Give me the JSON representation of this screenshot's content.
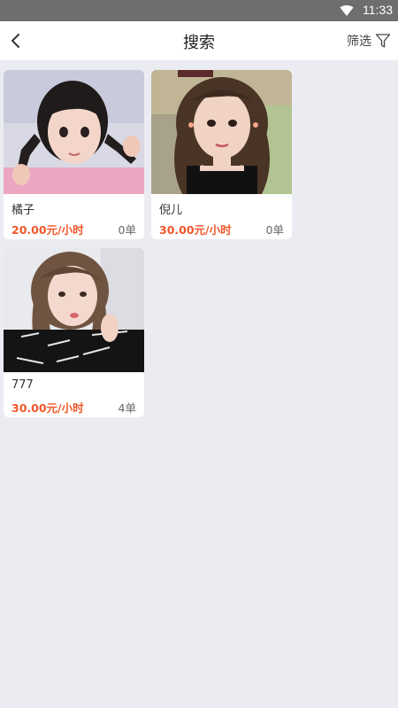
{
  "status_bar": {
    "time": "11:33",
    "wifi_icon": "wifi-icon"
  },
  "header": {
    "title": "搜索",
    "back_icon": "chevron-left-icon",
    "filter_label": "筛选",
    "filter_icon": "funnel-icon"
  },
  "results": [
    {
      "name": "橘子",
      "price": "20.00元/小时",
      "orders": "0单"
    },
    {
      "name": "倪儿",
      "price": "30.00元/小时",
      "orders": "0单"
    },
    {
      "name": "777",
      "price": "30.00元/小时",
      "orders": "4单"
    }
  ],
  "colors": {
    "price": "#f0572a",
    "background": "#ebecf1",
    "status_bar": "#6e6e6e"
  }
}
